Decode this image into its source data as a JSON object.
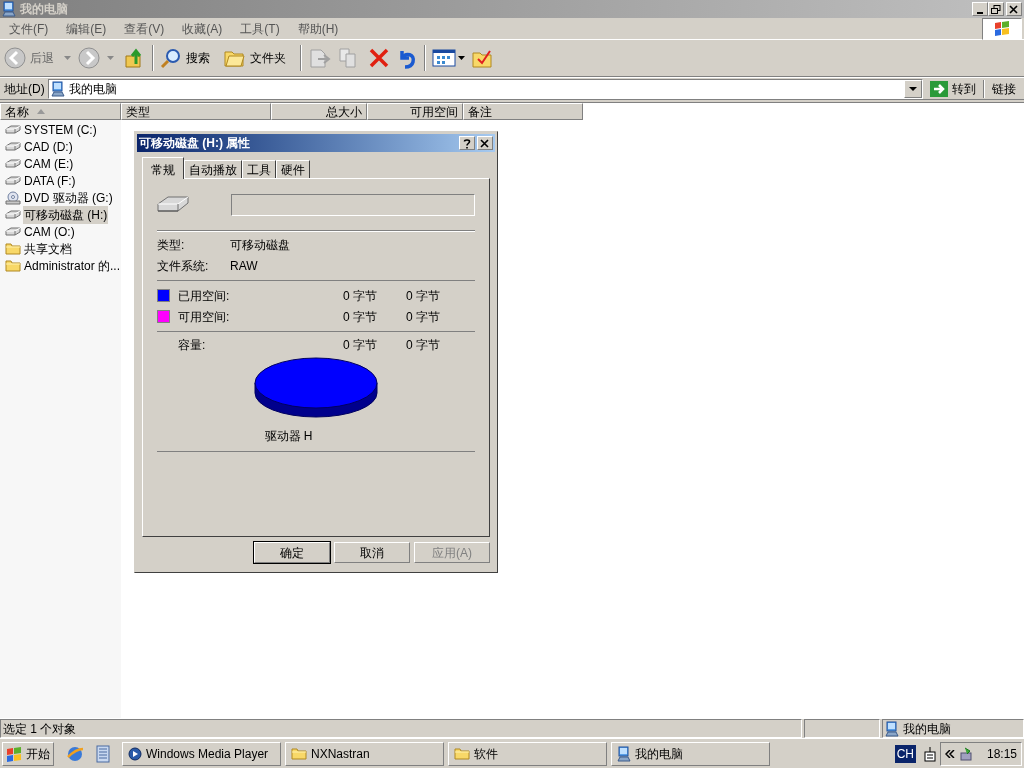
{
  "window": {
    "title": "我的电脑"
  },
  "menu": [
    "文件(F)",
    "编辑(E)",
    "查看(V)",
    "收藏(A)",
    "工具(T)",
    "帮助(H)"
  ],
  "toolbar": {
    "back": "后退",
    "search": "搜索",
    "folders": "文件夹"
  },
  "address": {
    "label": "地址(D)",
    "value": "我的电脑",
    "go": "转到",
    "links": "链接"
  },
  "columns": [
    {
      "label": "名称",
      "sorted": true
    },
    {
      "label": "类型",
      "sorted": false
    },
    {
      "label": "总大小",
      "sorted": false
    },
    {
      "label": "可用空间",
      "sorted": false
    },
    {
      "label": "备注",
      "sorted": false
    }
  ],
  "rows": [
    {
      "name": "SYSTEM (C:)",
      "kind": "drive",
      "selected": false
    },
    {
      "name": "CAD (D:)",
      "kind": "drive",
      "selected": false
    },
    {
      "name": "CAM (E:)",
      "kind": "drive",
      "selected": false
    },
    {
      "name": "DATA (F:)",
      "kind": "drive",
      "selected": false
    },
    {
      "name": "DVD 驱动器 (G:)",
      "kind": "dvd",
      "selected": false
    },
    {
      "name": "可移动磁盘 (H:)",
      "kind": "drive",
      "selected": true
    },
    {
      "name": "CAM (O:)",
      "kind": "drive",
      "selected": false
    },
    {
      "name": "共享文档",
      "kind": "folder",
      "selected": false
    },
    {
      "name": "Administrator 的...",
      "kind": "folder",
      "selected": false
    }
  ],
  "dialog": {
    "title": "可移动磁盘 (H:) 属性",
    "tabs": [
      {
        "label": "常规",
        "selected": true
      },
      {
        "label": "自动播放",
        "selected": false
      },
      {
        "label": "工具",
        "selected": false
      },
      {
        "label": "硬件",
        "selected": false
      }
    ],
    "info": [
      {
        "label": "类型:",
        "value": "可移动磁盘"
      },
      {
        "label": "文件系统:",
        "value": "RAW"
      }
    ],
    "space": [
      {
        "label": "已用空间:",
        "color": "#0000ff",
        "bytes": "0 字节",
        "size": "0 字节"
      },
      {
        "label": "可用空间:",
        "color": "#ff00ff",
        "bytes": "0 字节",
        "size": "0 字节"
      }
    ],
    "capacity": {
      "label": "容量:",
      "bytes": "0 字节",
      "size": "0 字节"
    },
    "drive_caption": "驱动器 H",
    "buttons": [
      {
        "label": "确定",
        "disabled": false,
        "default": true
      },
      {
        "label": "取消",
        "disabled": false,
        "default": false
      },
      {
        "label": "应用(A)",
        "disabled": true,
        "default": false
      }
    ]
  },
  "status_bar": {
    "text": "选定 1 个对象",
    "location": "我的电脑"
  },
  "taskbar": {
    "start": "开始",
    "tasks": [
      {
        "label": "Windows Media Player"
      },
      {
        "label": "NXNastran"
      },
      {
        "label": "软件"
      },
      {
        "label": "我的电脑"
      }
    ],
    "language": "CH",
    "clock": "18:15"
  }
}
